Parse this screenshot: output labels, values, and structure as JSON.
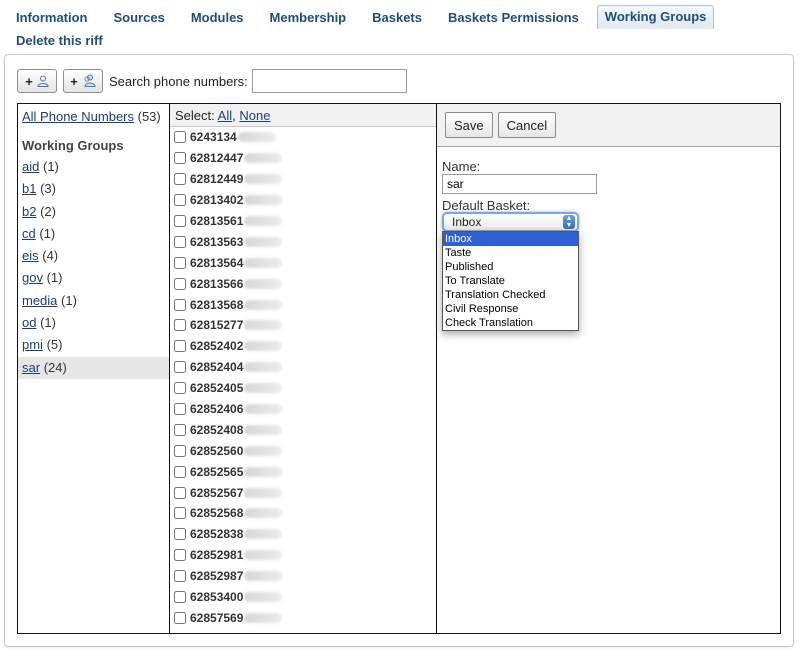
{
  "nav": {
    "tabs": [
      {
        "label": "Information"
      },
      {
        "label": "Sources"
      },
      {
        "label": "Modules"
      },
      {
        "label": "Membership"
      },
      {
        "label": "Baskets"
      },
      {
        "label": "Baskets Permissions"
      },
      {
        "label": "Working Groups"
      }
    ],
    "active_tab": "Working Groups",
    "delete_label": "Delete this riff"
  },
  "toolbar": {
    "add_person_plus": "+",
    "add_group_plus": "+",
    "search_label": "Search phone numbers:",
    "search_value": ""
  },
  "groups": {
    "all_label": "All Phone Numbers",
    "all_count": "(53)",
    "heading": "Working Groups",
    "items": [
      {
        "name": "aid",
        "count": "(1)"
      },
      {
        "name": "b1",
        "count": "(3)"
      },
      {
        "name": "b2",
        "count": "(2)"
      },
      {
        "name": "cd",
        "count": "(1)"
      },
      {
        "name": "eis",
        "count": "(4)"
      },
      {
        "name": "gov",
        "count": "(1)"
      },
      {
        "name": "media",
        "count": "(1)"
      },
      {
        "name": "od",
        "count": "(1)"
      },
      {
        "name": "pmi",
        "count": "(5)"
      },
      {
        "name": "sar",
        "count": "(24)"
      }
    ],
    "selected": "sar"
  },
  "numbers": {
    "select_label": "Select:",
    "all_link": "All",
    "separator": ",",
    "none_link": "None",
    "items": [
      "6243134",
      "62812447",
      "62812449",
      "62813402",
      "62813561",
      "62813563",
      "62813564",
      "62813566",
      "62813568",
      "62815277",
      "62852402",
      "62852404",
      "62852405",
      "62852406",
      "62852408",
      "62852560",
      "62852565",
      "62852567",
      "62852568",
      "62852838",
      "62852981",
      "62852987",
      "62853400",
      "62857569"
    ]
  },
  "detail": {
    "save_label": "Save",
    "cancel_label": "Cancel",
    "name_label": "Name:",
    "name_value": "sar",
    "basket_label": "Default Basket:",
    "basket_selected": "Inbox",
    "basket_options": [
      "Inbox",
      "Taste",
      "Published",
      "To Translate",
      "Translation Checked",
      "Civil Response",
      "Check Translation"
    ]
  },
  "icons": {
    "add_person": "person-icon",
    "add_group": "group-icon",
    "select_arrows": "updown-arrows-icon"
  },
  "colors": {
    "link": "#1a3f7a",
    "tab_text": "#1f4e7a",
    "highlight": "#2c62d3",
    "selected_row": "#e6e6e6"
  }
}
